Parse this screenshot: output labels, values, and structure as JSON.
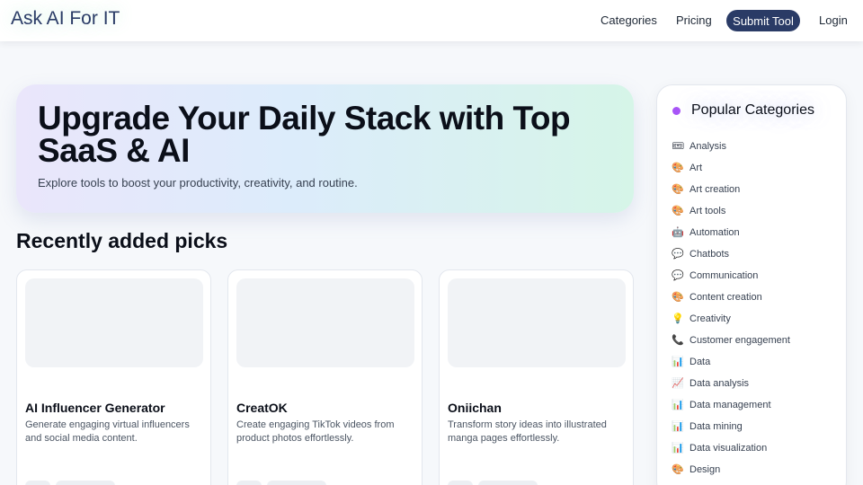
{
  "header": {
    "brand": "Ask AI For IT",
    "nav": {
      "categories": "Categories",
      "pricing": "Pricing",
      "submit_tool": "Submit Tool",
      "login": "Login"
    }
  },
  "hero": {
    "title": "Upgrade Your Daily Stack with Top SaaS & AI",
    "subtitle": "Explore tools to boost your productivity, creativity, and routine."
  },
  "recent": {
    "title": "Recently added picks",
    "cards": [
      {
        "name": "AI Influencer Generator",
        "description": "Generate engaging virtual influencers and social media content."
      },
      {
        "name": "CreatOK",
        "description": "Create engaging TikTok videos from product photos effortlessly."
      },
      {
        "name": "Oniichan",
        "description": "Transform story ideas into illustrated manga pages effortlessly."
      }
    ]
  },
  "sidebar": {
    "title": "Popular Categories",
    "accent_color": "#a855f7",
    "categories": [
      {
        "icon": "ticket-icon",
        "glyph": "🎟",
        "label": "Analysis"
      },
      {
        "icon": "palette-icon",
        "glyph": "🎨",
        "label": "Art"
      },
      {
        "icon": "palette-icon",
        "glyph": "🎨",
        "label": "Art creation"
      },
      {
        "icon": "palette-icon",
        "glyph": "🎨",
        "label": "Art tools"
      },
      {
        "icon": "robot-icon",
        "glyph": "🤖",
        "label": "Automation"
      },
      {
        "icon": "speech-bubble-icon",
        "glyph": "💬",
        "label": "Chatbots"
      },
      {
        "icon": "speech-bubble-icon",
        "glyph": "💬",
        "label": "Communication"
      },
      {
        "icon": "palette-icon",
        "glyph": "🎨",
        "label": "Content creation"
      },
      {
        "icon": "lightbulb-icon",
        "glyph": "💡",
        "label": "Creativity"
      },
      {
        "icon": "phone-icon",
        "glyph": "📞",
        "label": "Customer engagement"
      },
      {
        "icon": "bar-chart-icon",
        "glyph": "📊",
        "label": "Data"
      },
      {
        "icon": "trend-chart-icon",
        "glyph": "📈",
        "label": "Data analysis"
      },
      {
        "icon": "bar-chart-icon",
        "glyph": "📊",
        "label": "Data management"
      },
      {
        "icon": "bar-chart-icon",
        "glyph": "📊",
        "label": "Data mining"
      },
      {
        "icon": "bar-chart-icon",
        "glyph": "📊",
        "label": "Data visualization"
      },
      {
        "icon": "design-icon",
        "glyph": "🎨",
        "label": "Design"
      }
    ]
  },
  "colors": {
    "brand": "#2a3b66",
    "submit_button": "#2a3b66"
  }
}
